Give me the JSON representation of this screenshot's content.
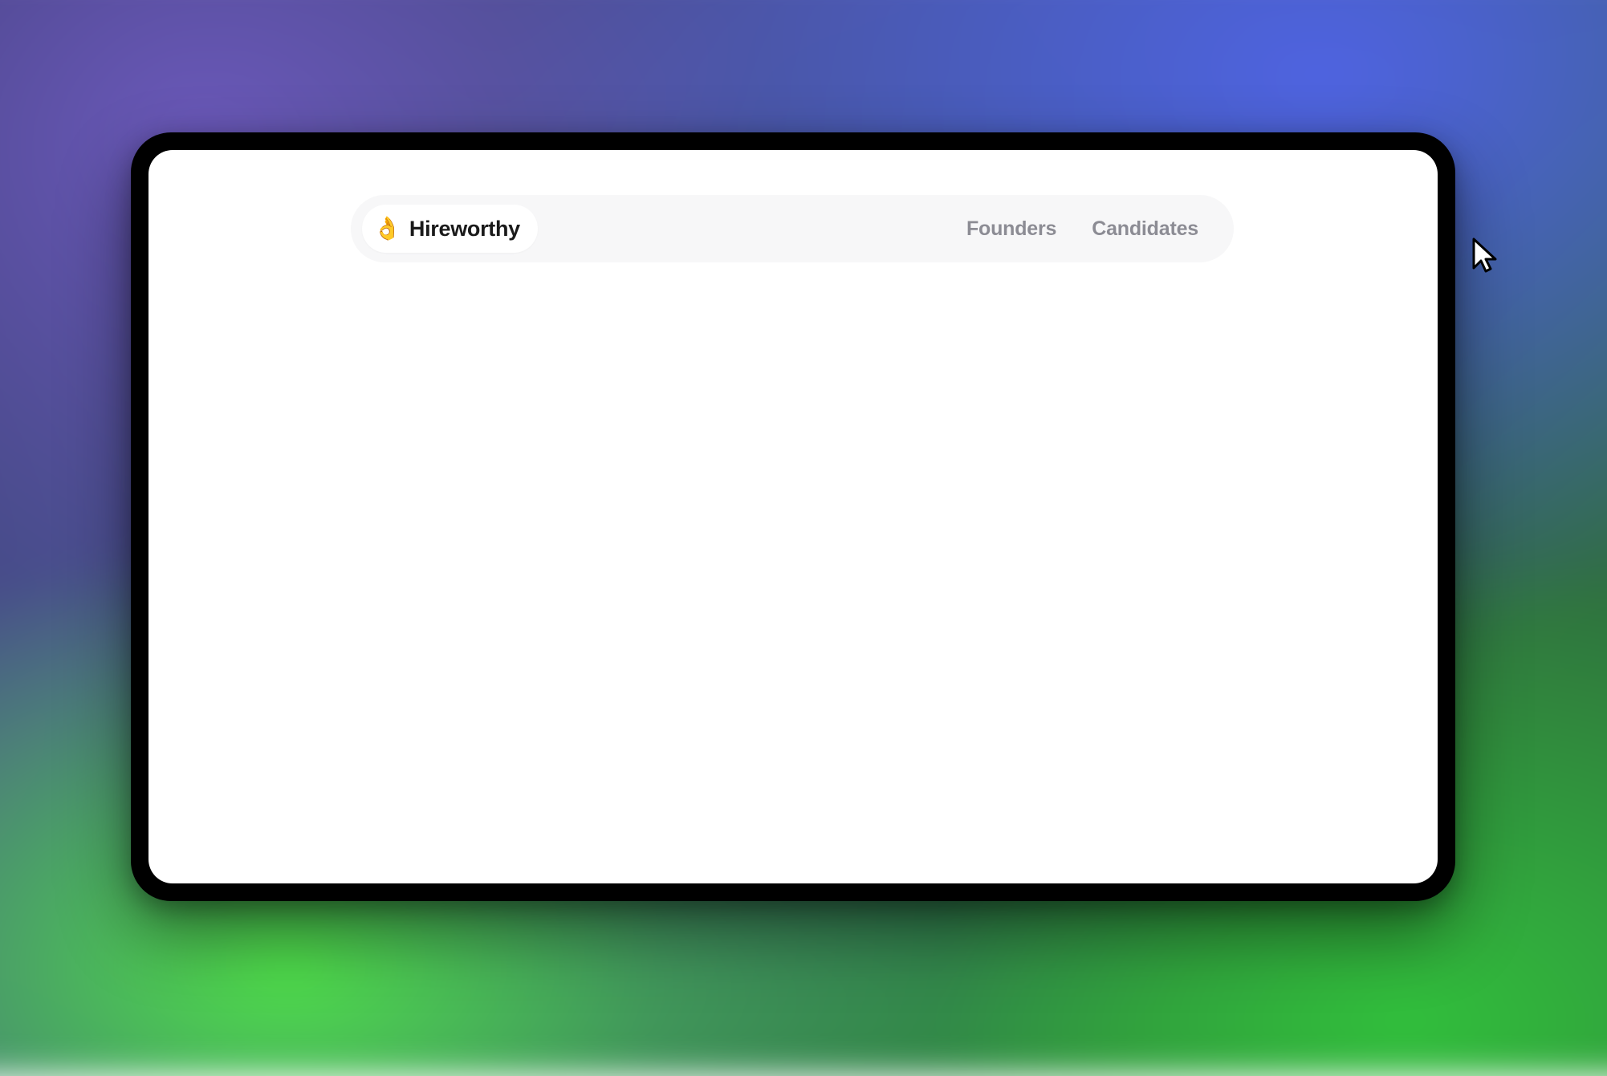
{
  "brand": {
    "icon": "👌",
    "name": "Hireworthy"
  },
  "nav": {
    "links": [
      {
        "label": "Founders"
      },
      {
        "label": "Candidates"
      }
    ]
  }
}
